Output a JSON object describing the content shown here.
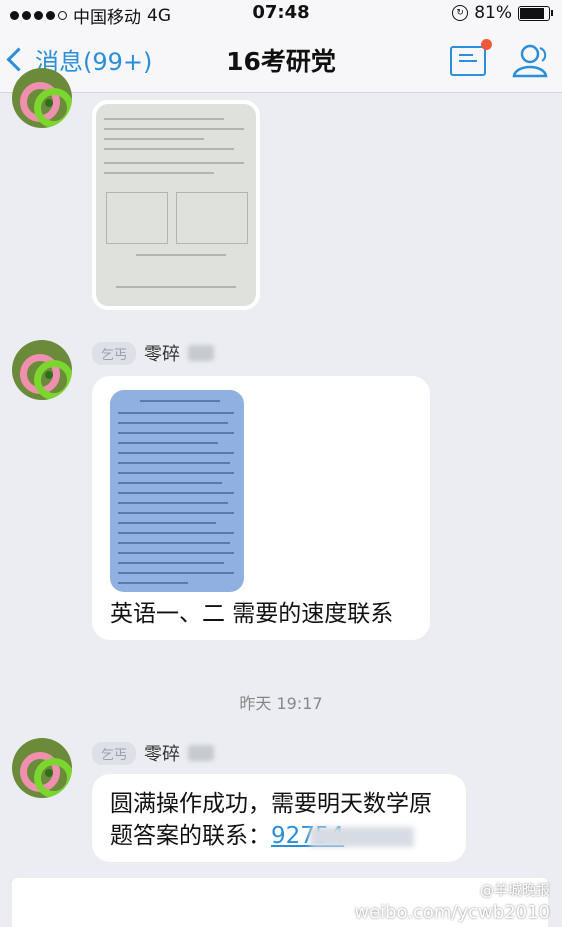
{
  "status_bar": {
    "carrier": "中国移动",
    "network": "4G",
    "time": "07:48",
    "battery": "81%"
  },
  "nav": {
    "back_label": "消息(99+)",
    "title": "16考研党"
  },
  "messages": [
    {
      "tag": "乞丐",
      "sender": "零碎",
      "image_caption": "",
      "text": "英语一、二 需要的速度联系"
    },
    {
      "tag": "乞丐",
      "sender": "零碎",
      "text_line1": "圆满操作成功，需要明天数学原",
      "text_line2": "题答案的联系：",
      "phone_visible": "92754"
    }
  ],
  "timestamp": "昨天 19:17",
  "watermark": {
    "handle": "@羊城晚报",
    "url": "weibo.com/ycwb2010"
  },
  "colors": {
    "accent": "#2a8ed9",
    "badge": "#f05a3c",
    "background": "#ebedf2"
  }
}
